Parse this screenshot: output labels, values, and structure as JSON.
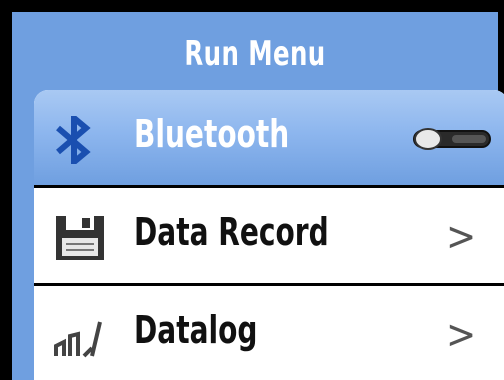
{
  "header": {
    "title": "Run Menu"
  },
  "menu": {
    "items": [
      {
        "label": "Bluetooth",
        "icon": "bluetooth-icon",
        "control": "toggle",
        "toggle_state": "off"
      },
      {
        "label": "Data Record",
        "icon": "floppy-disk-icon",
        "control": "chevron",
        "chevron": ">"
      },
      {
        "label": "Datalog",
        "icon": "datalog-chart-icon",
        "control": "chevron",
        "chevron": ">"
      }
    ]
  },
  "colors": {
    "background": "#6f9fe0",
    "selected_row": "#8db6ee",
    "title_text": "#ffffff"
  }
}
